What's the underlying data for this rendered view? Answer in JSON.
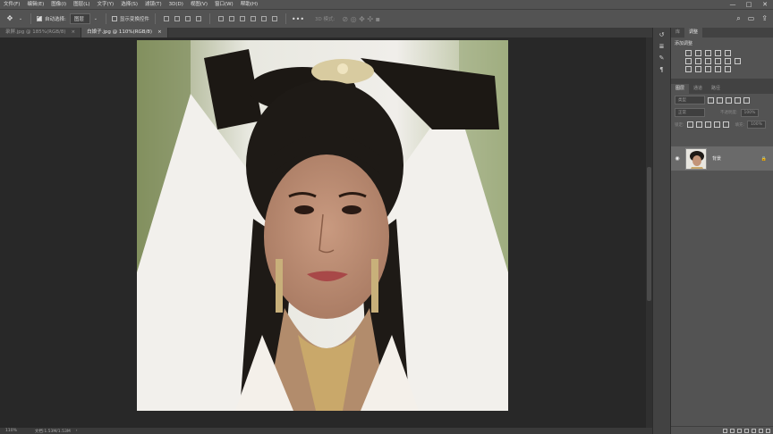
{
  "menu": [
    "文件(F)",
    "编辑(E)",
    "图像(I)",
    "图层(L)",
    "文字(Y)",
    "选择(S)",
    "滤镜(T)",
    "3D(D)",
    "视图(V)",
    "窗口(W)",
    "帮助(H)"
  ],
  "window_controls": [
    "—",
    "□",
    "✕"
  ],
  "options": {
    "auto_select_label": "自动选择:",
    "auto_select_value": "图层",
    "show_transform_label": "显示变换控件",
    "mode_3d_label": "3D 模式:"
  },
  "tabs": [
    {
      "label": "录屏.jpg @ 185%(RGB/8)",
      "active": false
    },
    {
      "label": "白娘子.jpg @ 110%(RGB/8)",
      "active": true
    }
  ],
  "status": {
    "zoom": "110%",
    "doc_info": "文档:1.53M/1.53M"
  },
  "panels": {
    "top_tabs": [
      "库",
      "调整"
    ],
    "adjust_title": "添加调整",
    "layer_tabs": [
      "图层",
      "通道",
      "路径"
    ],
    "kind_label": "类型",
    "blend_mode": "正常",
    "opacity_label": "不透明度:",
    "opacity_value": "100%",
    "lock_label": "锁定:",
    "fill_label": "填充:",
    "fill_value": "100%",
    "layer_name": "背景"
  },
  "icons": {
    "move": "move-tool-icon",
    "search": "search-icon",
    "workspace": "workspace-icon",
    "share": "share-icon"
  }
}
